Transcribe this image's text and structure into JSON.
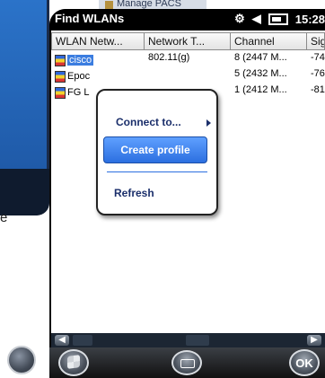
{
  "background": {
    "letter": "e",
    "top_strip_label": "Manage PACS"
  },
  "window": {
    "title": "Find WLANs",
    "time": "15:28"
  },
  "table": {
    "headers": [
      "WLAN Netw...",
      "Network T...",
      "Channel",
      "Sig"
    ],
    "rows": [
      {
        "name": "cisco",
        "type": "802.11(g)",
        "channel": "8 (2447 M...",
        "signal": "-74",
        "selected": true
      },
      {
        "name": "Epoc",
        "type": "",
        "channel": "5 (2432 M...",
        "signal": "-76",
        "selected": false
      },
      {
        "name": "FG L",
        "type": "",
        "channel": "1 (2412 M...",
        "signal": "-81",
        "selected": false
      }
    ]
  },
  "context_menu": {
    "connect_label": "Connect to...",
    "create_label": "Create profile",
    "refresh_label": "Refresh"
  },
  "bottom": {
    "ok_label": "OK"
  },
  "colors": {
    "selection": "#3b7de0",
    "menu_highlight": "#2c6fe0",
    "menu_text": "#1b2f6b"
  }
}
